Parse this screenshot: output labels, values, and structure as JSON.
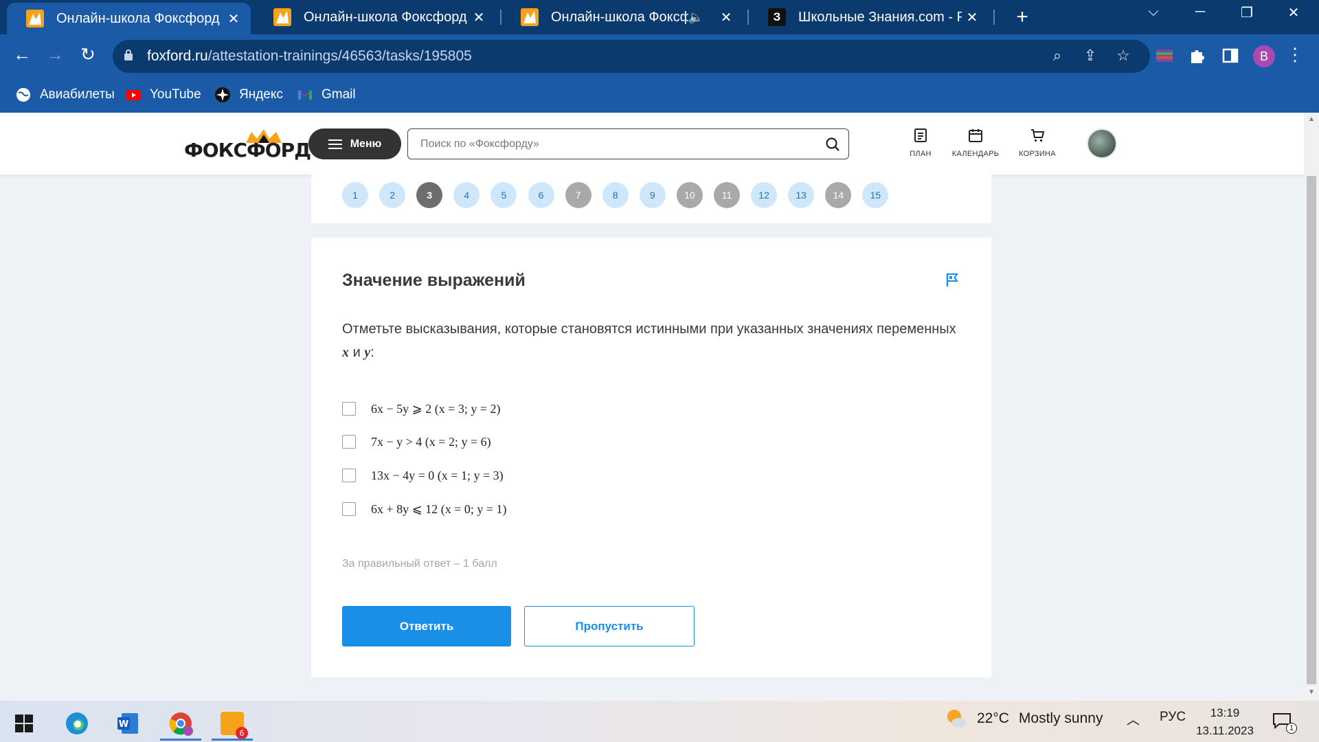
{
  "browser": {
    "tabs": [
      {
        "title": "Онлайн-школа Фоксфорд",
        "active": true
      },
      {
        "title": "Онлайн-школа Фоксфорд",
        "active": false
      },
      {
        "title": "Онлайн-школа Фоксфорд",
        "active": false,
        "muted_icon": "speaker-icon"
      },
      {
        "title": "Школьные Знания.com - Реша",
        "active": false,
        "favicon_letter": "З"
      }
    ],
    "url_host": "foxford.ru",
    "url_path": "/attestation-trainings/46563/tasks/195805",
    "profile_letter": "B",
    "bookmarks": [
      {
        "label": "Авиабилеты",
        "icon": "globe-icon"
      },
      {
        "label": "YouTube",
        "icon": "youtube-icon"
      },
      {
        "label": "Яндекс",
        "icon": "yandex-icon"
      },
      {
        "label": "Gmail",
        "icon": "gmail-icon"
      }
    ],
    "colors": {
      "tabstrip": "#0b3a6e",
      "toolbar": "#1a5aa6"
    }
  },
  "site": {
    "logo": "ФОКСФОРД",
    "menu_label": "Меню",
    "search_placeholder": "Поиск по «Фоксфорду»",
    "nav": [
      {
        "label": "ПЛАН",
        "icon": "plan-icon"
      },
      {
        "label": "КАЛЕНДАРЬ",
        "icon": "calendar-icon"
      },
      {
        "label": "КОРЗИНА",
        "icon": "cart-icon"
      }
    ]
  },
  "pager": {
    "pages": [
      "1",
      "2",
      "3",
      "4",
      "5",
      "6",
      "7",
      "8",
      "9",
      "10",
      "11",
      "12",
      "13",
      "14",
      "15"
    ],
    "current": "3",
    "grey": [
      "7",
      "10",
      "11",
      "14"
    ]
  },
  "task": {
    "title": "Значение выражений",
    "question_part1": "Отметьте высказывания, которые становятся истинными при указанных значениях переменных",
    "var_x": "x",
    "conj": "и",
    "var_y": "y",
    "colon": ":",
    "options": [
      "6x − 5y ⩾ 2 (x = 3; y = 2)",
      "7x − y > 4 (x = 2; y = 6)",
      "13x − 4y = 0 (x = 1; y = 3)",
      "6x + 8y ⩽ 12 (x = 0; y = 1)"
    ],
    "score_note": "За правильный ответ – 1 балл",
    "answer_label": "Ответить",
    "skip_label": "Пропустить",
    "accent": "#1a8fe8"
  },
  "taskbar": {
    "weather_temp": "22°C",
    "weather_text": "Mostly sunny",
    "lang": "РУС",
    "time": "13:19",
    "date": "13.11.2023",
    "notif_count": "1",
    "app_badge": "6"
  }
}
